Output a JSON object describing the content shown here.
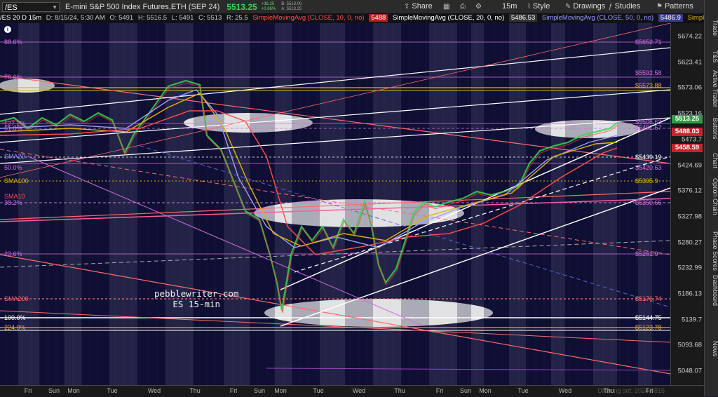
{
  "toolbar": {
    "symbol": "/ES",
    "instrument": "E-mini S&P 500 Index Futures,ETH (SEP 24)",
    "last": "5513.25",
    "change": "+36.25",
    "change_pct": "+0.66%",
    "bid": "B: 5513.00",
    "ask": "A: 5513.25",
    "share_label": "Share",
    "timeframe_label": "15m",
    "style_label": "Style",
    "drawings_label": "Drawings",
    "studies_label": "Studies",
    "patterns_label": "Patterns"
  },
  "infobar": {
    "period": "/ES 20 D 15m",
    "ohlc": "D: 8/15/24, 5:30 AM",
    "open": "O: 5491",
    "high": "H: 5516.5",
    "low": "L: 5491",
    "close": "C: 5513",
    "range": "R: 25.5",
    "sma10_label": "SimpleMovingAvg (CLOSE, 10, 0, no)",
    "sma10_value": "5488",
    "sma20_label": "SimpleMovingAvg (CLOSE, 20, 0, no)",
    "sma20_value": "5486.53",
    "sma50_label": "SimpleMovingAvg (CLOSE, 50, 0, no)",
    "sma50_value": "5486.9",
    "sma_more": "Simple..."
  },
  "colors": {
    "sma10": "#ff4d4d",
    "sma20": "#9a9cff",
    "sma50": "#e0b400",
    "fib": "#d36fe0",
    "sma200": "#ff6a6a",
    "up": "#39d353",
    "down": "#ff3b30"
  },
  "y_axis": {
    "ticks": [
      "5674.22",
      "5623.41",
      "5573.06",
      "5523.16",
      "5473.7",
      "5424.69",
      "5376.12",
      "5327.98",
      "5280.27",
      "5232.99",
      "5186.13",
      "5139.7",
      "5093.68",
      "5048.07"
    ],
    "tags": [
      {
        "text": "5513.25",
        "color": "#2e9e3e"
      },
      {
        "text": "5488.03",
        "color": "#c0262a"
      },
      {
        "text": "5458.59",
        "color": "#c0262a"
      }
    ]
  },
  "x_axis": {
    "labels": [
      "Fri",
      "Sun",
      "Mon",
      "Tue",
      "Wed",
      "Thu",
      "Fri",
      "Sun",
      "Mon",
      "Tue",
      "Wed",
      "Thu",
      "Fri",
      "Sun",
      "Mon",
      "Tue",
      "Wed",
      "Thu",
      "Fri"
    ],
    "drawing_set": "Drawing set: 2024-0815"
  },
  "levels": [
    {
      "text": "88.6%",
      "color": "#d36fe0",
      "side": "left"
    },
    {
      "text": "78.6%",
      "color": "#d36fe0",
      "side": "left"
    },
    {
      "text": "127.2%",
      "color": "#d36fe0",
      "side": "left"
    },
    {
      "text": "61.8%",
      "color": "#d36fe0",
      "side": "left"
    },
    {
      "text": "SMA20",
      "color": "#9a9cff",
      "side": "left"
    },
    {
      "text": "50.0%",
      "color": "#d36fe0",
      "side": "left"
    },
    {
      "text": "SMA100",
      "color": "#e0b400",
      "side": "left"
    },
    {
      "text": "SMA10",
      "color": "#ff4d4d",
      "side": "left"
    },
    {
      "text": "38.2%",
      "color": "#d36fe0",
      "side": "left"
    },
    {
      "text": "23.6%",
      "color": "#d36fe0",
      "side": "left"
    },
    {
      "text": "SMA200",
      "color": "#ff6a6a",
      "side": "left"
    },
    {
      "text": "100.0%",
      "color": "#ffffff",
      "side": "left"
    },
    {
      "text": "224.0%",
      "color": "#e0b400",
      "side": "left"
    },
    {
      "text": "$5652.71",
      "color": "#d36fe0",
      "side": "right"
    },
    {
      "text": "$5592.58",
      "color": "#d36fe0",
      "side": "right"
    },
    {
      "text": "$5573.88",
      "color": "#e0b400",
      "side": "right"
    },
    {
      "text": "$5506.63",
      "color": "#d36fe0",
      "side": "right"
    },
    {
      "text": "$5491.57",
      "color": "#d36fe0",
      "side": "right"
    },
    {
      "text": "$5439.19",
      "color": "#ffffff",
      "side": "right"
    },
    {
      "text": "$5420.63",
      "color": "#d36fe0",
      "side": "right"
    },
    {
      "text": "$5395.9",
      "color": "#e0b400",
      "side": "right"
    },
    {
      "text": "$5350.66",
      "color": "#d36fe0",
      "side": "right"
    },
    {
      "text": "$5261.9",
      "color": "#d36fe0",
      "side": "right"
    },
    {
      "text": "$5176.74",
      "color": "#ff6a6a",
      "side": "right"
    },
    {
      "text": "$5144.75",
      "color": "#ffffff",
      "side": "right"
    },
    {
      "text": "$5123.78",
      "color": "#e0b400",
      "side": "right"
    }
  ],
  "watermark": {
    "line1": "pebblewriter.com",
    "line2": "ES 15-min"
  },
  "sidebar": [
    "Trade",
    "T&S",
    "Active Trader",
    "Buttons",
    "Chart",
    "Option Chain",
    "Phase Scores",
    "Dashboard",
    "News"
  ]
}
